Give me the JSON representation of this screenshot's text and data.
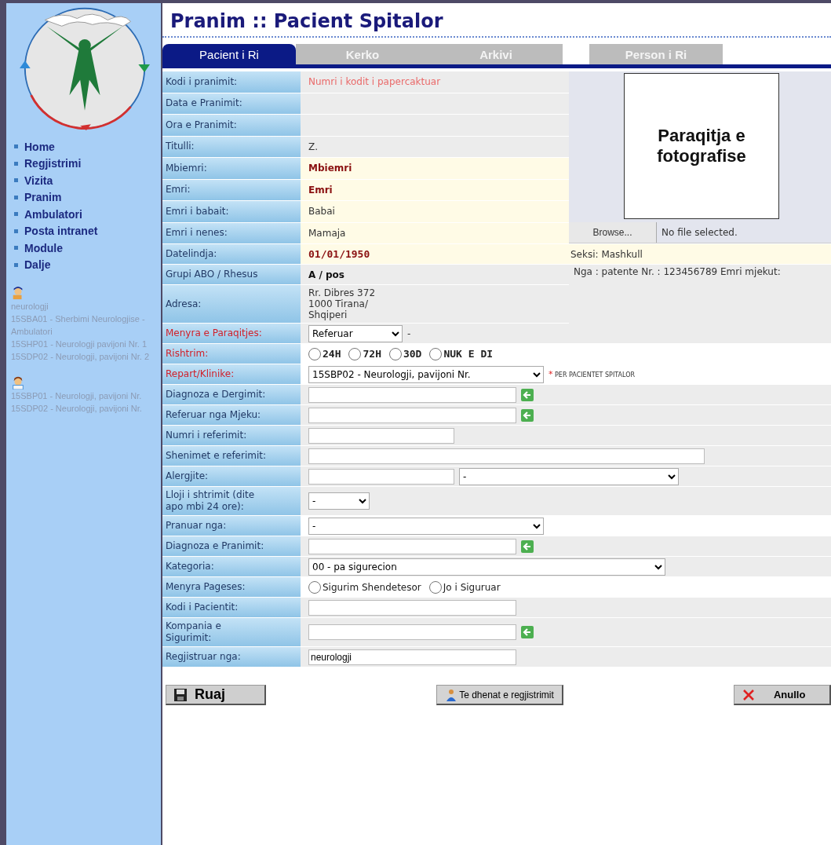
{
  "sidebar": {
    "nav": [
      {
        "label": "Home"
      },
      {
        "label": "Regjistrimi"
      },
      {
        "label": "Vizita"
      },
      {
        "label": "Pranim"
      },
      {
        "label": "Ambulatori"
      },
      {
        "label": "Posta intranet"
      },
      {
        "label": "Module"
      },
      {
        "label": "Dalje"
      }
    ],
    "users": [
      {
        "kind": "doctor",
        "lines": [
          "neurologji",
          "15SBA01 - Sherbimi Neurologjise - Ambulatori",
          "15SHP01 - Neurologji pavijoni Nr. 1",
          "15SDP02 - Neurologji, pavijoni Nr. 2"
        ]
      },
      {
        "kind": "nurse",
        "lines": [
          "15SBP01 - Neurologji, pavijoni Nr.",
          "15SDP02 - Neurologji, pavijoni Nr."
        ]
      }
    ]
  },
  "title": "Pranim :: Pacient Spitalor",
  "tabs": [
    {
      "label": "Pacient i Ri",
      "selected": true
    },
    {
      "label": "Kerko",
      "selected": false
    },
    {
      "label": "Arkivi",
      "selected": false
    }
  ],
  "side_tab": {
    "label": "Person i Ri",
    "selected": false
  },
  "photo": {
    "caption": "Paraqitja e fotografise",
    "browse_button": "Browse...",
    "file_status": "No file selected."
  },
  "sex": "Seksi: Mashkull",
  "document": "Nga : patente   Nr. : 123456789   Emri mjekut:",
  "rows": [
    {
      "label": "Kodi i pranimit:",
      "required": false,
      "kind": "text",
      "value": "Numri i kodit i papercaktuar",
      "red": true,
      "bold": false,
      "highlighted": false
    },
    {
      "label": "Data e Pranimit:",
      "required": false,
      "kind": "text",
      "highlighted": false
    },
    {
      "label": "Ora e Pranimit:",
      "required": false,
      "kind": "text",
      "highlighted": false
    },
    {
      "label": "Titulli:",
      "required": false,
      "kind": "text",
      "value": "Z.",
      "red": false,
      "bold": false,
      "highlighted": false
    },
    {
      "label": "Mbiemri:",
      "required": false,
      "kind": "text",
      "value": "Mbiemri",
      "red": true,
      "bold": true,
      "highlighted": true
    },
    {
      "label": "Emri:",
      "required": false,
      "kind": "text",
      "value": "Emri",
      "red": true,
      "bold": true,
      "highlighted": true
    },
    {
      "label": "Emri i babait:",
      "required": false,
      "kind": "text",
      "value": "Babai",
      "red": false,
      "bold": false,
      "highlighted": true
    },
    {
      "label": "Emri i nenes:",
      "required": false,
      "kind": "text",
      "value": "Mamaja",
      "red": false,
      "bold": false,
      "highlighted": true
    },
    {
      "label": "Datelindja:",
      "required": false,
      "kind": "date",
      "value": "01/01/1950",
      "red": true,
      "bold": true,
      "highlighted": true
    },
    {
      "label": "Grupi ABO / Rhesus",
      "required": false,
      "kind": "text",
      "value": "A / pos",
      "red": false,
      "bold": true,
      "highlighted": false
    },
    {
      "label": "Adresa:",
      "required": false,
      "kind": "lines",
      "lines": [
        "Rr. Dibres 372",
        "1000 Tirana/",
        "Shqiperi"
      ]
    },
    {
      "label": "Menyra e Paraqitjes:",
      "required": true,
      "kind": "short_select",
      "value": "Referuar",
      "suffix": "-"
    },
    {
      "label": "Rishtrim:",
      "required": true,
      "kind": "radio",
      "options": [
        {
          "label": "24H",
          "selected": false
        },
        {
          "label": "72H",
          "selected": false
        },
        {
          "label": "30D",
          "selected": false
        },
        {
          "label": "NUK E DI",
          "selected": false
        }
      ],
      "bold": true
    },
    {
      "label": "Repart/Klinike:",
      "required": true,
      "kind": "select",
      "value": "15SBP02 - Neurologji, pavijoni Nr.",
      "note_mark": "*",
      "note": "PER PACIENTET SPITALOR"
    },
    {
      "label": "Diagnoza e Dergimit:",
      "required": false,
      "kind": "lookup"
    },
    {
      "label": "Referuar nga Mjeku:",
      "required": false,
      "kind": "lookup"
    },
    {
      "label": "Numri i referimit:",
      "required": false,
      "kind": "short_input"
    },
    {
      "label": "Shenimet e referimit:",
      "required": false,
      "kind": "long_input"
    },
    {
      "label": "Alergjite:",
      "required": false,
      "kind": "input_select",
      "select_value": "-"
    },
    {
      "label": "Lloji i shtrimit (dite apo mbi 24 ore):",
      "required": false,
      "kind": "tiny_select",
      "value": "-"
    },
    {
      "label": "Pranuar nga:",
      "required": false,
      "kind": "select",
      "value": "-"
    },
    {
      "label": "Diagnoza e Pranimit:",
      "required": false,
      "kind": "lookup"
    },
    {
      "label": "Kategoria:",
      "required": false,
      "kind": "long_select",
      "value": "00 - pa sigurecion"
    },
    {
      "label": "Menyra Pageses:",
      "required": false,
      "kind": "radio",
      "options": [
        {
          "label": "Sigurim Shendetesor",
          "selected": false
        },
        {
          "label": "Jo i Siguruar",
          "selected": false
        }
      ],
      "bold": false
    },
    {
      "label": "Kodi i Pacientit:",
      "required": false,
      "kind": "input"
    },
    {
      "label": "Kompania e Sigurimit:",
      "required": false,
      "kind": "lookup"
    },
    {
      "label": "Regjistruar nga:",
      "required": false,
      "kind": "input",
      "value": "neurologji"
    }
  ],
  "buttons": [
    {
      "kind": "save",
      "label": "Ruaj"
    },
    {
      "kind": "details",
      "label": "Te dhenat e regjistrimit"
    },
    {
      "kind": "cancel",
      "label": "Anullo"
    }
  ]
}
